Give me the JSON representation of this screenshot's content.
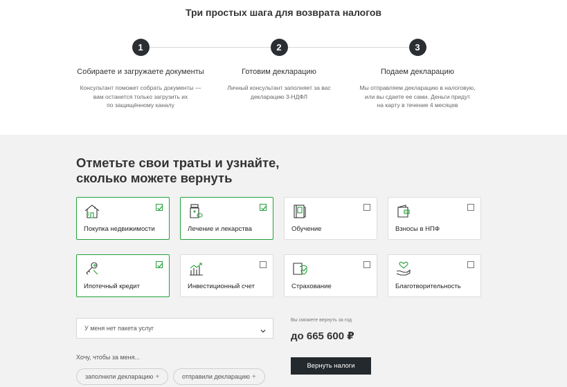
{
  "steps_section": {
    "title": "Три простых шага для возврата налогов",
    "steps": [
      {
        "number": "1",
        "title": "Собираете и загружаете документы",
        "description": "Консультант поможет собрать документы —\nвам останется только загрузить их\nпо защищённому каналу"
      },
      {
        "number": "2",
        "title": "Готовим декларацию",
        "description": "Личный консультант заполняет за вас\nдекларацию 3-НДФЛ"
      },
      {
        "number": "3",
        "title": "Подаем декларацию",
        "description": "Мы отправляем декларацию в налоговую,\nили вы сдаете ее сами. Деньги придут\nна карту в течение 4 месяцев"
      }
    ]
  },
  "calculator": {
    "title": "Отметьте свои траты и узнайте,\nсколько можете вернуть",
    "cards": [
      {
        "label": "Покупка недвижимости",
        "icon": "house-icon",
        "checked": true
      },
      {
        "label": "Лечение и лекарства",
        "icon": "medicine-icon",
        "checked": true
      },
      {
        "label": "Обучение",
        "icon": "book-icon",
        "checked": false
      },
      {
        "label": "Взносы в НПФ",
        "icon": "wallet-icon",
        "checked": false
      },
      {
        "label": "Ипотечный кредит",
        "icon": "keys-icon",
        "checked": true
      },
      {
        "label": "Инвестиционный счет",
        "icon": "growth-chart-icon",
        "checked": false
      },
      {
        "label": "Страхование",
        "icon": "shield-icon",
        "checked": false
      },
      {
        "label": "Благотворительность",
        "icon": "heart-hand-icon",
        "checked": false
      }
    ],
    "package_select": {
      "value": "У меня нет пакета услуг"
    },
    "want_label": "Хочу, чтобы за меня...",
    "chips": [
      {
        "label": "заполнили декларацию",
        "plus": "+"
      },
      {
        "label": "отправили декларацию",
        "plus": "+"
      }
    ],
    "return_label": "Вы сможете вернуть за год",
    "return_value": "до 665 600 ₽",
    "return_button": "Вернуть налоги"
  },
  "colors": {
    "accent": "#21a038",
    "dark": "#24292d",
    "background": "#f2f2f2"
  }
}
